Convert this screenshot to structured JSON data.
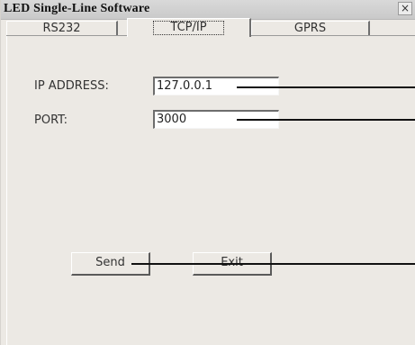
{
  "window": {
    "title": "LED Single-Line Software",
    "close_label": "×"
  },
  "tabs": [
    {
      "label": "RS232",
      "active": false
    },
    {
      "label": "TCP/IP",
      "active": true
    },
    {
      "label": "GPRS",
      "active": false
    }
  ],
  "form": {
    "ip_label": "IP ADDRESS:",
    "ip_value": "127.0.0.1",
    "port_label": "PORT:",
    "port_value": "3000"
  },
  "buttons": {
    "send_label": "Send",
    "exit_label": "Exit"
  }
}
